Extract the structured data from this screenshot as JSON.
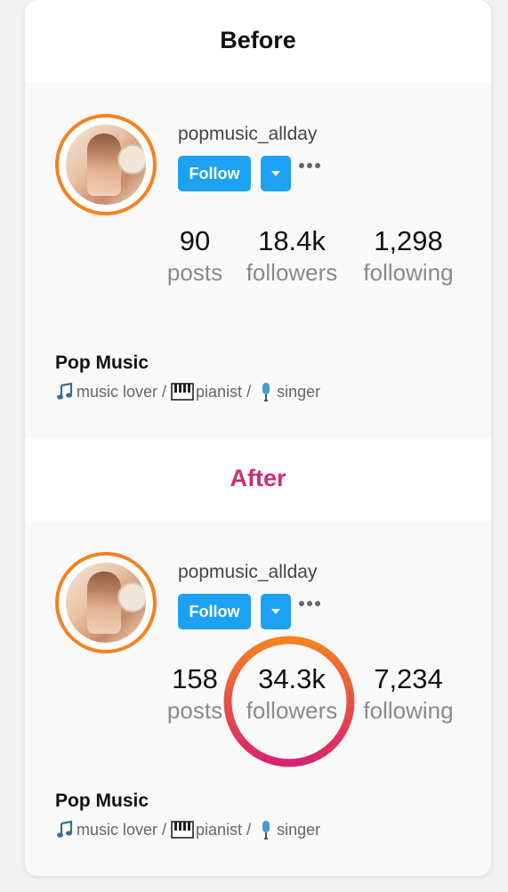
{
  "sections": {
    "before": {
      "title": "Before",
      "username": "popmusic_allday",
      "follow_label": "Follow",
      "stats": {
        "posts": {
          "value": "90",
          "label": "posts"
        },
        "followers": {
          "value": "18.4k",
          "label": "followers"
        },
        "following": {
          "value": "1,298",
          "label": "following"
        }
      },
      "bio_name": "Pop Music",
      "bio_parts": {
        "p1": "music lover /",
        "p2": "pianist /",
        "p3": "singer"
      }
    },
    "after": {
      "title": "After",
      "username": "popmusic_allday",
      "follow_label": "Follow",
      "stats": {
        "posts": {
          "value": "158",
          "label": "posts"
        },
        "followers": {
          "value": "34.3k",
          "label": "followers"
        },
        "following": {
          "value": "7,234",
          "label": "following"
        }
      },
      "bio_name": "Pop Music",
      "bio_parts": {
        "p1": "music lover /",
        "p2": "pianist /",
        "p3": "singer"
      }
    }
  },
  "colors": {
    "follow_button": "#1da1f2",
    "avatar_ring": "#f5821f",
    "after_title": "#cc2f73",
    "highlight_gradient": [
      "#f5821f",
      "#d6246e"
    ]
  },
  "icons": [
    "more-icon",
    "chevron-down-icon",
    "music-note-icon",
    "piano-icon",
    "microphone-icon"
  ]
}
